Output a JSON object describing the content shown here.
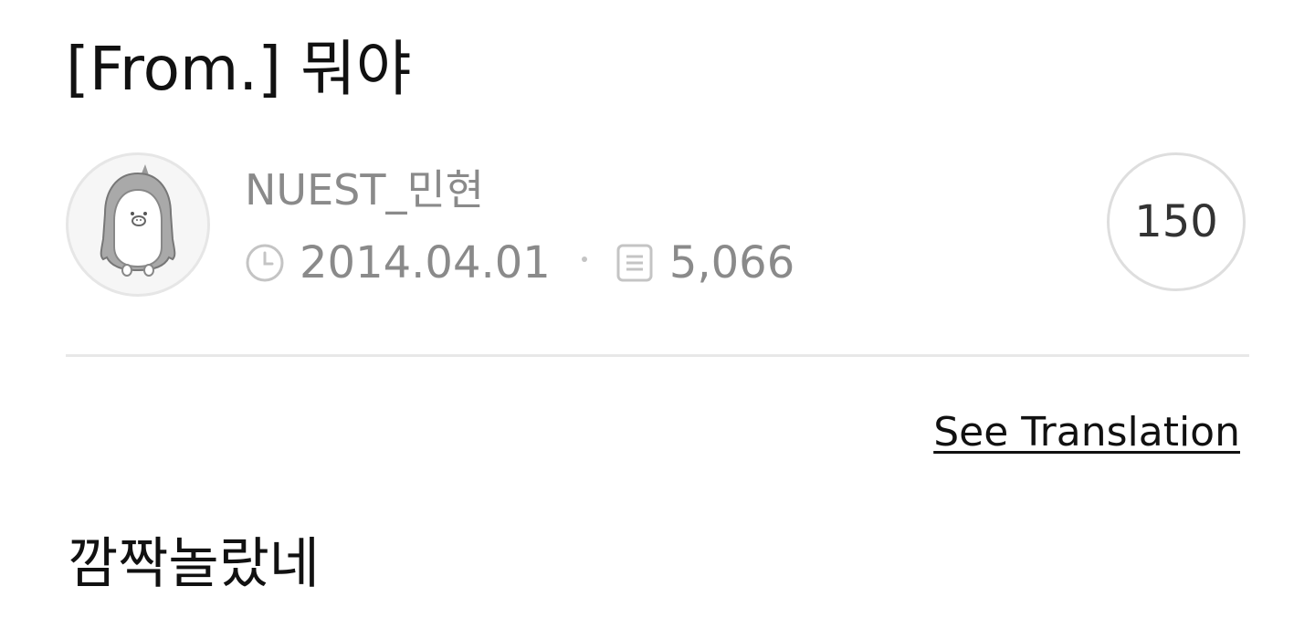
{
  "post": {
    "title": "[From.] 뭐야",
    "author": "NUEST_민현",
    "date": "2014.04.01",
    "views": "5,066",
    "comment_count": "150",
    "translate_label": "See Translation",
    "body": "깜짝놀랐네"
  },
  "icons": {
    "avatar": "penguin-avatar",
    "date": "clock-icon",
    "views": "document-icon"
  },
  "colors": {
    "meta_text": "#8a8a8a",
    "divider": "#e8e8e8",
    "circle_border": "#dedede"
  }
}
